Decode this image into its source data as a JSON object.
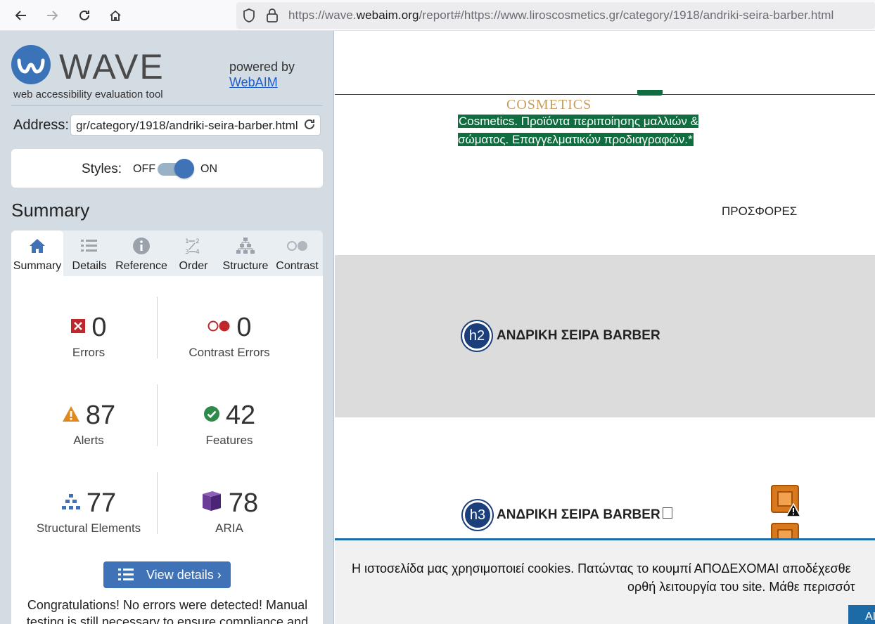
{
  "browser": {
    "url_prefix": "https://wave.",
    "url_domain": "webaim.org",
    "url_rest": "/report#/https://www.liroscosmetics.gr/category/1918/andriki-seira-barber.html"
  },
  "sidebar": {
    "logo_word": "WAVE",
    "logo_tagline": "web accessibility evaluation tool",
    "powered_by": "powered by",
    "powered_link": "WebAIM",
    "address_label": "Address:",
    "address_value": "gr/category/1918/andriki-seira-barber.html",
    "styles_label": "Styles:",
    "styles_off": "OFF",
    "styles_on": "ON",
    "summary_title": "Summary",
    "tabs": [
      {
        "label": "Summary"
      },
      {
        "label": "Details"
      },
      {
        "label": "Reference"
      },
      {
        "label": "Order"
      },
      {
        "label": "Structure"
      },
      {
        "label": "Contrast"
      }
    ],
    "stats": {
      "errors": {
        "count": "0",
        "label": "Errors"
      },
      "contrast_errors": {
        "count": "0",
        "label": "Contrast Errors"
      },
      "alerts": {
        "count": "87",
        "label": "Alerts"
      },
      "features": {
        "count": "42",
        "label": "Features"
      },
      "structural": {
        "count": "77",
        "label": "Structural Elements"
      },
      "aria": {
        "count": "78",
        "label": "ARIA"
      }
    },
    "view_details": "View details ›",
    "congrats": "Congratulations! No errors were detected! Manual testing is still necessary to ensure compliance and"
  },
  "page": {
    "cosmetics": "COSMETICS",
    "description": "Cosmetics. Προϊόντα περιποίησης μαλλιών & σώματος. Επαγγελματικών προδιαγραφών.*",
    "offers": "ΠΡΟΣΦΟΡΕΣ",
    "h2_badge": "h2",
    "h2_text": "ΑΝΔΡΙΚΗ ΣΕΙΡΑ BARBER",
    "h3_badge": "h3",
    "h3_text": "ΑΝΔΡΙΚΗ ΣΕΙΡΑ BARBER",
    "cookie_line1": "Η ιστοσελίδα μας χρησιμοποιεί cookies. Πατώντας το κουμπί ΑΠΟΔΕΧΟΜΑΙ αποδέχεσθε",
    "cookie_line2": "ορθή λειτουργία του site. Μάθε περισσότ",
    "cookie_button": "AI"
  }
}
